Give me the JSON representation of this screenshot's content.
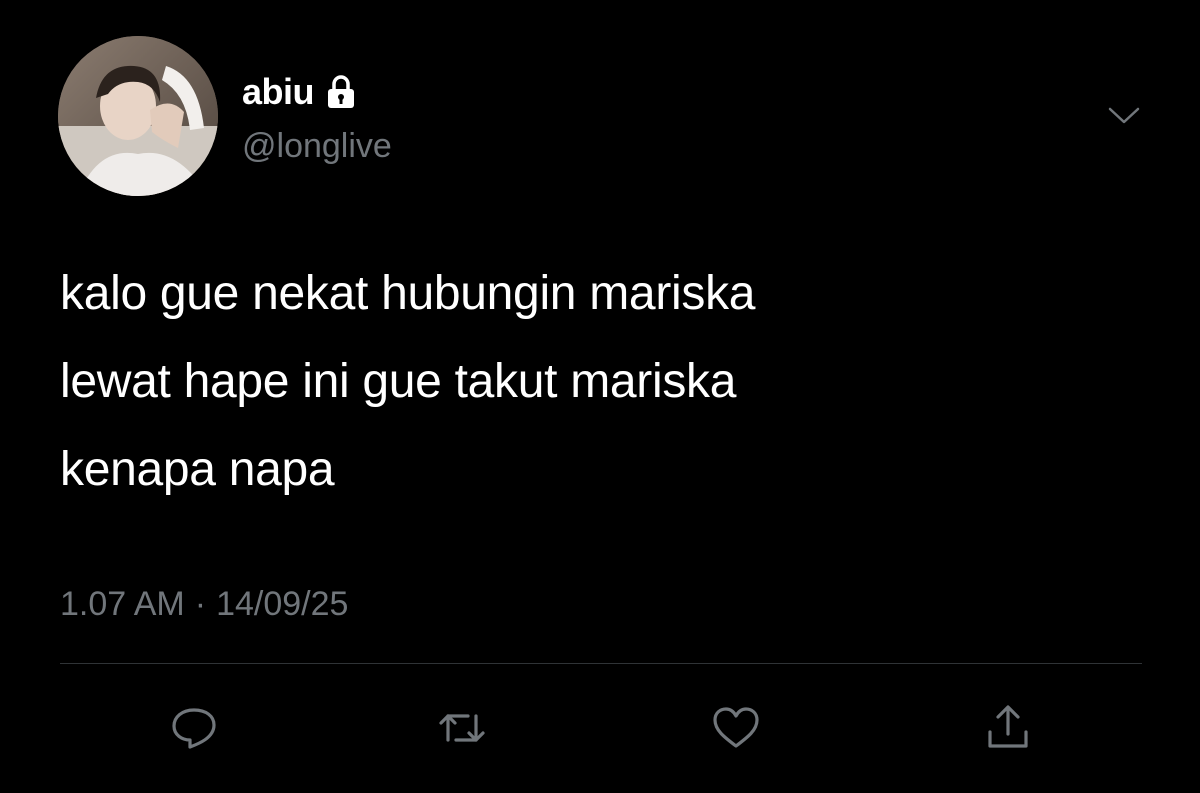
{
  "colors": {
    "background": "#000000",
    "primary_text": "#ffffff",
    "secondary_text": "#71767b",
    "divider": "#2f3336",
    "icon": "#71767b"
  },
  "author": {
    "display_name": "abiu",
    "handle": "@longlive",
    "protected_icon": "lock-icon",
    "avatar_icon": "profile-photo"
  },
  "tweet": {
    "lines": [
      "kalo gue nekat hubungin mariska",
      "lewat hape ini gue takut mariska",
      "kenapa napa"
    ],
    "time": "1.07 AM",
    "separator": "·",
    "date": "14/09/25"
  },
  "actions": [
    {
      "name": "reply",
      "icon": "speech-bubble-icon"
    },
    {
      "name": "retweet",
      "icon": "retweet-arrows-icon"
    },
    {
      "name": "like",
      "icon": "heart-icon"
    },
    {
      "name": "share",
      "icon": "share-upload-icon"
    }
  ],
  "menu": {
    "icon": "chevron-down-icon"
  }
}
